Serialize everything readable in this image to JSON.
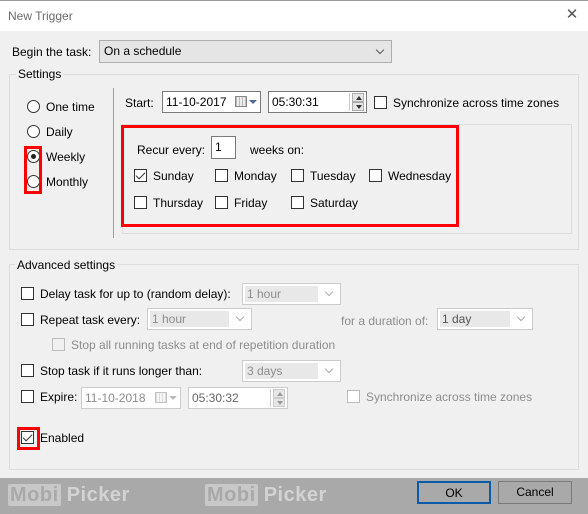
{
  "window": {
    "title": "New Trigger",
    "close_icon": "close-icon"
  },
  "begin": {
    "label": "Begin the task:",
    "value": "On a schedule"
  },
  "settings": {
    "legend": "Settings",
    "schedule_options": [
      {
        "label": "One time",
        "selected": false
      },
      {
        "label": "Daily",
        "selected": false
      },
      {
        "label": "Weekly",
        "selected": true
      },
      {
        "label": "Monthly",
        "selected": false
      }
    ],
    "start": {
      "label": "Start:",
      "date": "11-10-2017",
      "time": "05:30:31"
    },
    "sync": {
      "label": "Synchronize across time zones",
      "checked": false
    },
    "recur": {
      "label": "Recur every:",
      "value": "1",
      "suffix": "weeks on:"
    },
    "days": [
      {
        "label": "Sunday",
        "checked": true
      },
      {
        "label": "Monday",
        "checked": false
      },
      {
        "label": "Tuesday",
        "checked": false
      },
      {
        "label": "Wednesday",
        "checked": false
      },
      {
        "label": "Thursday",
        "checked": false
      },
      {
        "label": "Friday",
        "checked": false
      },
      {
        "label": "Saturday",
        "checked": false
      }
    ]
  },
  "advanced": {
    "legend": "Advanced settings",
    "delay": {
      "label": "Delay task for up to (random delay):",
      "value": "1 hour",
      "checked": false
    },
    "repeat": {
      "label": "Repeat task every:",
      "value": "1 hour",
      "checked": false,
      "duration_label": "for a duration of:",
      "duration_value": "1 day"
    },
    "stop_all": {
      "label": "Stop all running tasks at end of repetition duration",
      "checked": false
    },
    "stop_longer": {
      "label": "Stop task if it runs longer than:",
      "value": "3 days",
      "checked": false
    },
    "expire": {
      "label": "Expire:",
      "date": "11-10-2018",
      "time": "05:30:32",
      "checked": false,
      "sync_label": "Synchronize across time zones"
    },
    "enabled": {
      "label": "Enabled",
      "checked": true
    }
  },
  "footer": {
    "ok_label": "OK",
    "cancel_label": "Cancel",
    "watermark_left": "Mobi",
    "watermark_right": "Picker"
  },
  "annotation_color": "#ff0000"
}
